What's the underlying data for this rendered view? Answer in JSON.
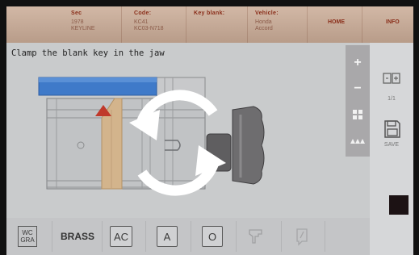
{
  "header": {
    "columns": [
      {
        "heading": "Sec",
        "values": [
          "1978",
          "KEYLINE"
        ]
      },
      {
        "heading": "Code:",
        "values": [
          "KC41",
          "KC03-N718"
        ]
      },
      {
        "heading": "Key blank:",
        "values": []
      },
      {
        "heading": "Vehicle:",
        "values": [
          "Honda",
          "Accord"
        ]
      }
    ],
    "home_label": "HOME",
    "info_label": "INFO"
  },
  "instruction": "Clamp the blank key in the jaw",
  "zoom": {
    "plus": "+",
    "minus": "−"
  },
  "rightpanel": {
    "page": "1/1",
    "save_label": "SAVE"
  },
  "toolbar": {
    "wc_top": "WC",
    "wc_bottom": "GRA",
    "material": "BRASS",
    "mode_ac": "AC",
    "mode_a": "A",
    "mode_o": "O"
  },
  "colors": {
    "header_bg": "#c4a897",
    "header_text": "#8a2e1a",
    "key_blank": "#d3b48c",
    "stop_marker": "#c0392b",
    "jaw_top": "#3f7ac9",
    "knob": "#6e6d6f"
  }
}
